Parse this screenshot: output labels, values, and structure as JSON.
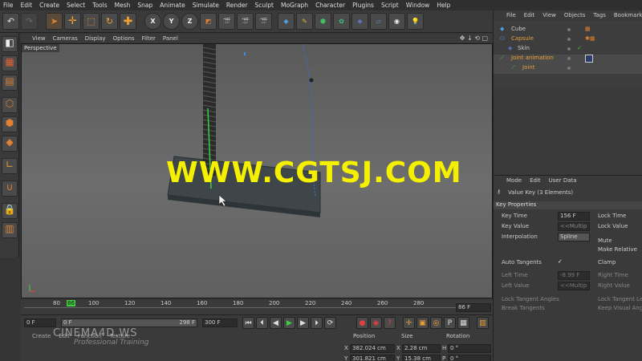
{
  "menubar": [
    "File",
    "Edit",
    "Create",
    "Select",
    "Tools",
    "Mesh",
    "Snap",
    "Animate",
    "Simulate",
    "Render",
    "Sculpt",
    "MoGraph",
    "Character",
    "Plugins",
    "Script",
    "Window",
    "Help"
  ],
  "viewport_menu": [
    "View",
    "Cameras",
    "Display",
    "Options",
    "Filter",
    "Panel"
  ],
  "viewport_label": "Perspective",
  "watermark": "WWW.CGTSJ.COM",
  "timeline": {
    "ticks": [
      "80",
      "86",
      "100",
      "120",
      "140",
      "160",
      "180",
      "200",
      "220",
      "240",
      "260",
      "280"
    ],
    "end_frame": "86 F"
  },
  "transport": {
    "start": "0 F",
    "range_start": "0 F",
    "range_end": "298 F",
    "end": "300 F"
  },
  "materials": {
    "menu": [
      "Create",
      "Edit",
      "Function",
      "Texture"
    ],
    "overlay_line1": "CINEMA4D.WS",
    "overlay_line2": "Professional Training"
  },
  "coords": {
    "headers": [
      "Position",
      "Size",
      "Rotation"
    ],
    "x_pos": "382.024 cm",
    "x_size": "2.28 cm",
    "h_rot": "0 °",
    "y_pos": "301.821 cm",
    "y_size": "15.38 cm",
    "p_rot": "0 °"
  },
  "objects_menu": [
    "File",
    "Edit",
    "View",
    "Objects",
    "Tags",
    "Bookmarks"
  ],
  "objects": [
    {
      "name": "Cube",
      "color": "#dddddd"
    },
    {
      "name": "Capsule",
      "color": "#e0a040"
    },
    {
      "name": "Skin",
      "color": "#dddddd"
    },
    {
      "name": "Joint animation",
      "color": "#f0a030"
    },
    {
      "name": "Joint",
      "color": "#e0a040"
    }
  ],
  "attr_menu": [
    "Mode",
    "Edit",
    "User Data"
  ],
  "attr_title": "Value Key (3 Elements)",
  "key_props": {
    "section": "Key Properties",
    "key_time_label": "Key Time",
    "key_time": "156 F",
    "key_value_label": "Key Value",
    "key_value": "<<Multip",
    "interp_label": "Interpolation",
    "interp": "Spline",
    "lock_time": "Lock Time",
    "lock_value": "Lock Value",
    "mute": "Mute",
    "make_relative": "Make Relative",
    "auto_tangents": "Auto Tangents",
    "clamp": "Clamp",
    "left_time_label": "Left Time",
    "left_time": "-8.99 F",
    "right_time": "Right Time",
    "left_value_label": "Left Value",
    "left_value": "<<Multip",
    "right_value": "Right Value",
    "lock_tangent_angles": "Lock Tangent Angles",
    "lock_tangent_len": "Lock Tangent Len",
    "break_tangents": "Break Tangents",
    "keep_visual_angle": "Keep Visual Angl"
  },
  "colors": {
    "accent": "#f5f000",
    "selected": "#e0a040"
  }
}
